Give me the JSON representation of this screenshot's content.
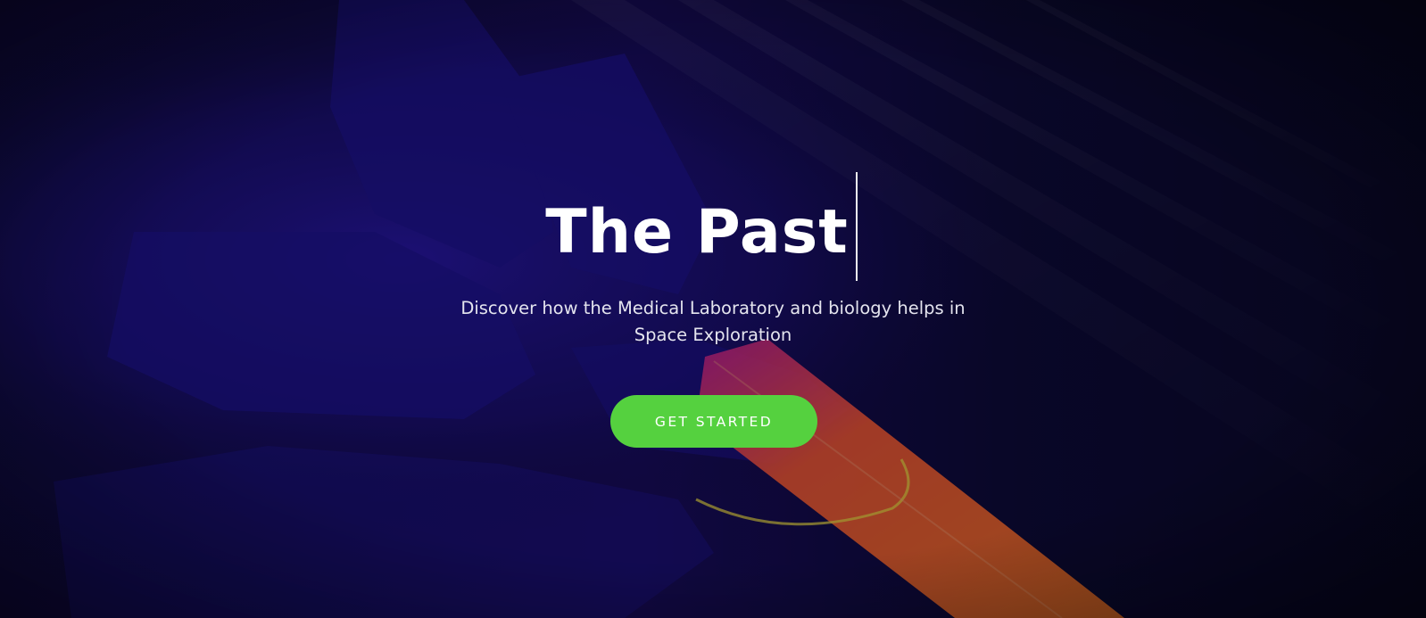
{
  "hero": {
    "title": "The Past",
    "subtitle": "Discover how the Medical Laboratory and biology helps in Space Exploration",
    "cta_label": "GET STARTED"
  },
  "colors": {
    "background_dark": "#07061a",
    "overlay_indigo": "#1a0f6b",
    "cta_green": "#55d13f",
    "text_white": "#ffffff",
    "tube_orange": "#ff6a1a"
  },
  "icons": {
    "cursor": "text-caret"
  }
}
